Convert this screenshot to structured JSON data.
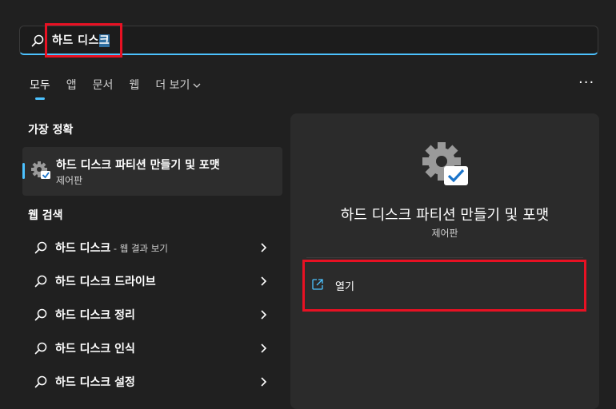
{
  "search": {
    "value_prefix": "하드 디스",
    "value_selected": "크"
  },
  "tabs": [
    {
      "label": "모두"
    },
    {
      "label": "앱"
    },
    {
      "label": "문서"
    },
    {
      "label": "웹"
    },
    {
      "label": "더 보기"
    }
  ],
  "more_menu": "···",
  "best_match": {
    "heading": "가장 정확",
    "title": "하드 디스크 파티션 만들기 및 포맷",
    "subtitle": "제어판"
  },
  "web_search": {
    "heading": "웹 검색",
    "items": [
      {
        "label": "하드 디스크",
        "suffix": " - 웹 결과 보기"
      },
      {
        "label": "하드 디스크 드라이브",
        "suffix": ""
      },
      {
        "label": "하드 디스크 정리",
        "suffix": ""
      },
      {
        "label": "하드 디스크 인식",
        "suffix": ""
      },
      {
        "label": "하드 디스크 설정",
        "suffix": ""
      }
    ]
  },
  "detail": {
    "title": "하드 디스크 파티션 만들기 및 포맷",
    "subtitle": "제어판",
    "open_label": "열기"
  },
  "colors": {
    "background": "#202020",
    "accent": "#4cc2ff",
    "highlight": "#e81123"
  }
}
